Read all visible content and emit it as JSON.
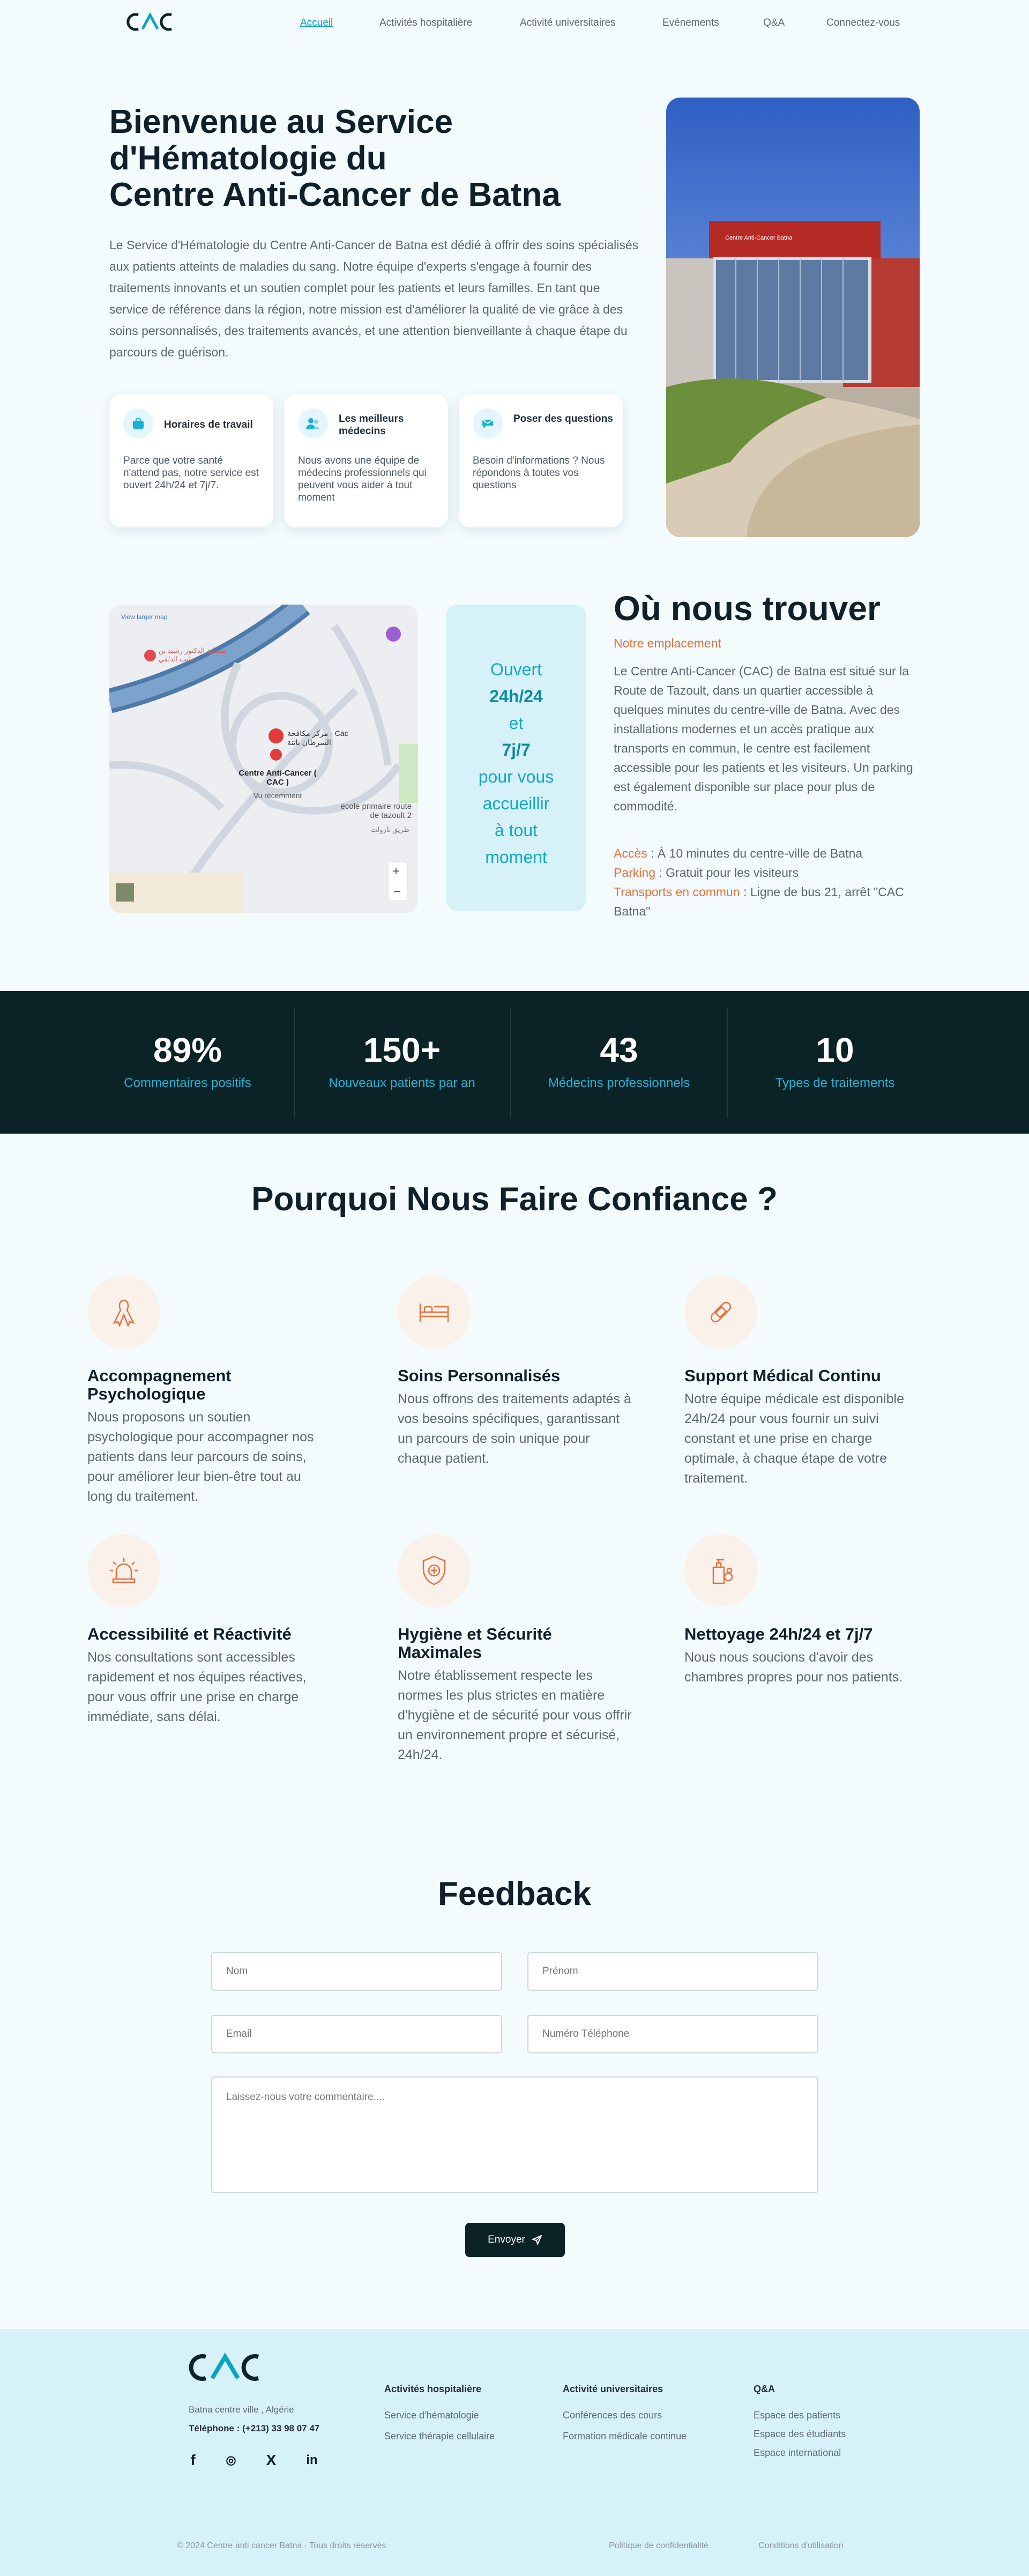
{
  "nav": {
    "links": [
      "Accueil",
      "Activités hospitalière",
      "Activité universitaires",
      "Evénements",
      "Q&A",
      "Connectez-vous"
    ]
  },
  "hero": {
    "title_lines": [
      "Bienvenue au Service",
      "d'Hématologie du",
      "Centre Anti-Cancer de Batna"
    ],
    "text": "Le Service d'Hématologie du Centre Anti-Cancer de Batna est dédié à offrir des soins spécialisés aux patients atteints de maladies du sang. Notre équipe d'experts s'engage à fournir des traitements innovants et un soutien complet pour les patients et leurs familles. En tant que service de référence dans la région, notre mission est d'améliorer la qualité de vie grâce à des soins personnalisés, des traitements avancés, et une attention bienveillante à chaque étape du parcours de guérison.",
    "cards": [
      {
        "icon": "briefcase-icon",
        "title": "Horaires de travail",
        "text": "Parce que votre santé n'attend pas, notre service est ouvert 24h/24 et 7j/7."
      },
      {
        "icon": "doctors-icon",
        "title": "Les meilleurs médecins",
        "text": "Nous avons une équipe de médecins professionnels qui peuvent vous aider à tout moment"
      },
      {
        "icon": "chat-icon",
        "title": "Poser des questions",
        "text": "Besoin d'informations ? Nous répondons à toutes vos questions"
      }
    ]
  },
  "map": {
    "view_larger": "View larger map",
    "place_ar": "مركز مكافحة - Cac السرطان باتنة",
    "place_name": "Centre Anti-Cancer ( CAC )",
    "place_sub": "Vu récemment",
    "pharmacy_ar": "صيدلية الدكتور رشيد بن طيب الدلفي",
    "school": "ecole primaire route de tazoult 2",
    "school_ar": "طريق تازولت",
    "zoom_in": "+",
    "zoom_out": "−"
  },
  "open": {
    "l1": "Ouvert",
    "l2": "24h/24",
    "l3": "et",
    "l4": "7j/7",
    "l5": "pour vous",
    "l6": "accueillir",
    "l7": "à tout",
    "l8": "moment"
  },
  "location": {
    "title": "Où nous trouver",
    "subtitle": "Notre emplacement",
    "text": "Le Centre Anti-Cancer (CAC) de Batna est situé sur la Route de Tazoult, dans un quartier accessible à quelques minutes du centre-ville de Batna. Avec des installations modernes et un accès pratique aux transports en commun, le centre est facilement accessible pour les patients et les visiteurs. Un parking est également disponible sur place pour plus de commodité.",
    "acces_k": "Accès",
    "acces_v": " : À 10 minutes du centre-ville de Batna",
    "parking_k": "Parking",
    "parking_v": " : Gratuit pour les visiteurs",
    "transport_k": "Transports en commun",
    "transport_v": " : Ligne de bus 21, arrêt \"CAC Batna\""
  },
  "stats": [
    {
      "value": "89%",
      "label": "Commentaires positifs"
    },
    {
      "value": "150+",
      "label": "Nouveaux patients par an"
    },
    {
      "value": "43",
      "label": "Médecins professionnels"
    },
    {
      "value": "10",
      "label": "Types de traitements"
    }
  ],
  "why": {
    "title": "Pourquoi Nous Faire Confiance ?",
    "items": [
      {
        "icon": "ribbon-icon",
        "title": "Accompagnement Psychologique",
        "text": "Nous proposons un soutien psychologique pour accompagner nos patients dans leur parcours de soins, pour améliorer leur bien-être tout au long du traitement."
      },
      {
        "icon": "hospital-bed-icon",
        "title": "Soins Personnalisés",
        "text": "Nous offrons des traitements adaptés à vos besoins spécifiques, garantissant un parcours de soin unique pour chaque patient."
      },
      {
        "icon": "bandage-icon",
        "title": "Support Médical Continu",
        "text": "Notre équipe médicale est disponible 24h/24 pour vous fournir un suivi constant et une prise en charge optimale, à chaque étape de votre traitement."
      },
      {
        "icon": "siren-icon",
        "title": "Accessibilité et Réactivité",
        "text": "Nos consultations sont accessibles rapidement et nos équipes réactives, pour vous offrir une prise en charge immédiate, sans délai."
      },
      {
        "icon": "shield-medical-icon",
        "title": "Hygiène et Sécurité Maximales",
        "text": "Notre établissement respecte les normes les plus strictes en matière d'hygiène et de sécurité pour vous offrir un environnement propre et sécurisé, 24h/24."
      },
      {
        "icon": "sanitizer-icon",
        "title": "Nettoyage 24h/24 et 7j/7",
        "text": "Nous nous soucions d'avoir des chambres propres pour nos patients."
      }
    ]
  },
  "feedback": {
    "title": "Feedback",
    "nom": "Nom",
    "prenom": "Prénom",
    "email": "Email",
    "phone": "Numéro Téléphone",
    "comment": "Laissez-nous votre commentaire....",
    "send": "Envoyer"
  },
  "footer": {
    "address": "Batna centre ville , Algérie",
    "phone": "Téléphone : (+213) 33 98 07 47",
    "col1_title": "Activités hospitalière",
    "col1": [
      "Service  d'hématologie",
      "Service  thérapie cellulaire"
    ],
    "col2_title": "Activité universitaires",
    "col2": [
      "Conférences des cours",
      "Formation médicale continue"
    ],
    "col3_title": "Q&A",
    "col3": [
      "Espace des patients",
      "Espace des étudiants",
      "Espace international"
    ],
    "copyright": "© 2024 Centre anti cancer Batna  ·  Tous droits réservés",
    "privacy": "Politique de confidentialité",
    "terms": "Conditions d'utilisation",
    "social": [
      "f",
      "◎",
      "X",
      "in"
    ]
  },
  "colors": {
    "accent": "#0aa3c2",
    "orange": "#e2703d",
    "dark": "#0b2226"
  }
}
